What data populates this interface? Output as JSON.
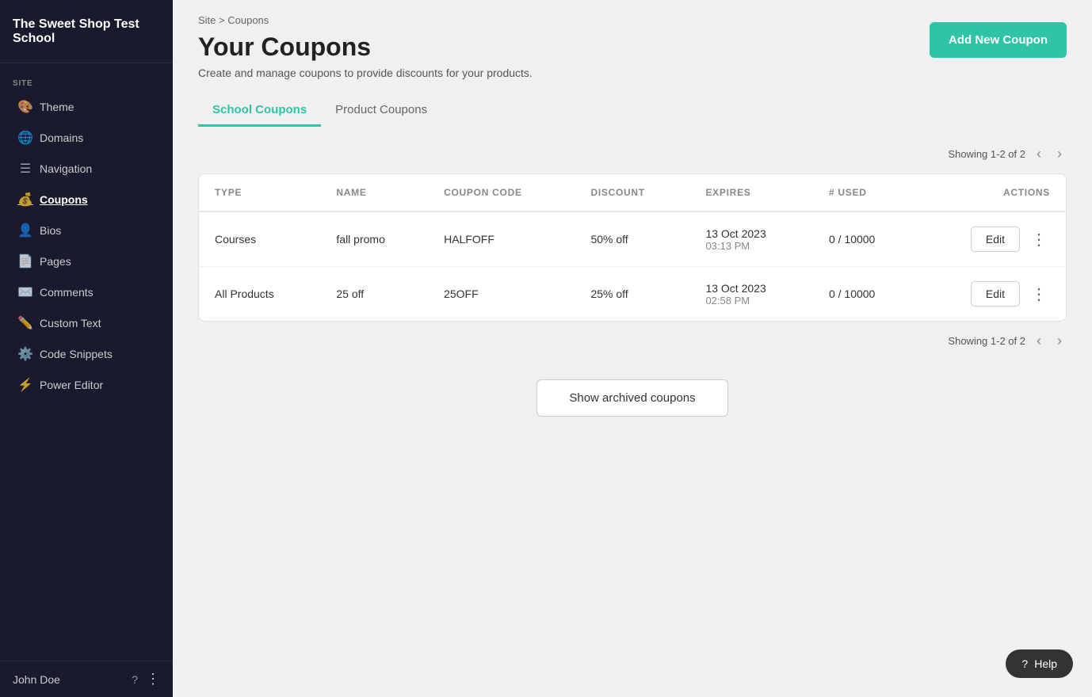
{
  "brand": {
    "name": "The Sweet Shop Test School"
  },
  "sidebar": {
    "section_label": "SITE",
    "items": [
      {
        "id": "theme",
        "label": "Theme",
        "icon": "🎨"
      },
      {
        "id": "domains",
        "label": "Domains",
        "icon": "🌐"
      },
      {
        "id": "navigation",
        "label": "Navigation",
        "icon": "☰"
      },
      {
        "id": "coupons",
        "label": "Coupons",
        "icon": "💰",
        "active": true
      },
      {
        "id": "bios",
        "label": "Bios",
        "icon": "👤"
      },
      {
        "id": "pages",
        "label": "Pages",
        "icon": "📄"
      },
      {
        "id": "comments",
        "label": "Comments",
        "icon": "✉️"
      },
      {
        "id": "custom-text",
        "label": "Custom Text",
        "icon": "✏️"
      },
      {
        "id": "code-snippets",
        "label": "Code Snippets",
        "icon": "⚙️"
      },
      {
        "id": "power-editor",
        "label": "Power Editor",
        "icon": "⚡"
      }
    ],
    "footer": {
      "user_name": "John Doe",
      "help_icon": "?",
      "user_icon": "👤",
      "more_icon": "⋮"
    }
  },
  "breadcrumb": {
    "site_label": "Site",
    "separator": ">",
    "current": "Coupons"
  },
  "page": {
    "title": "Your Coupons",
    "subtitle": "Create and manage coupons to provide discounts for your products.",
    "add_button_label": "Add New Coupon"
  },
  "tabs": [
    {
      "id": "school-coupons",
      "label": "School Coupons",
      "active": true
    },
    {
      "id": "product-coupons",
      "label": "Product Coupons",
      "active": false
    }
  ],
  "table": {
    "pagination_text": "Showing 1-2 of 2",
    "columns": [
      {
        "id": "type",
        "label": "TYPE"
      },
      {
        "id": "name",
        "label": "NAME"
      },
      {
        "id": "coupon_code",
        "label": "COUPON CODE"
      },
      {
        "id": "discount",
        "label": "DISCOUNT"
      },
      {
        "id": "expires",
        "label": "EXPIRES"
      },
      {
        "id": "used",
        "label": "# USED"
      },
      {
        "id": "actions",
        "label": "ACTIONS"
      }
    ],
    "rows": [
      {
        "type": "Courses",
        "name": "fall promo",
        "coupon_code": "HALFOFF",
        "discount": "50% off",
        "expires_line1": "13 Oct 2023",
        "expires_line2": "03:13 PM",
        "used": "0 / 10000",
        "edit_label": "Edit"
      },
      {
        "type": "All Products",
        "name": "25 off",
        "coupon_code": "25OFF",
        "discount": "25% off",
        "expires_line1": "13 Oct 2023",
        "expires_line2": "02:58 PM",
        "used": "0 / 10000",
        "edit_label": "Edit"
      }
    ]
  },
  "archived_button_label": "Show archived coupons",
  "help_button_label": "Help"
}
